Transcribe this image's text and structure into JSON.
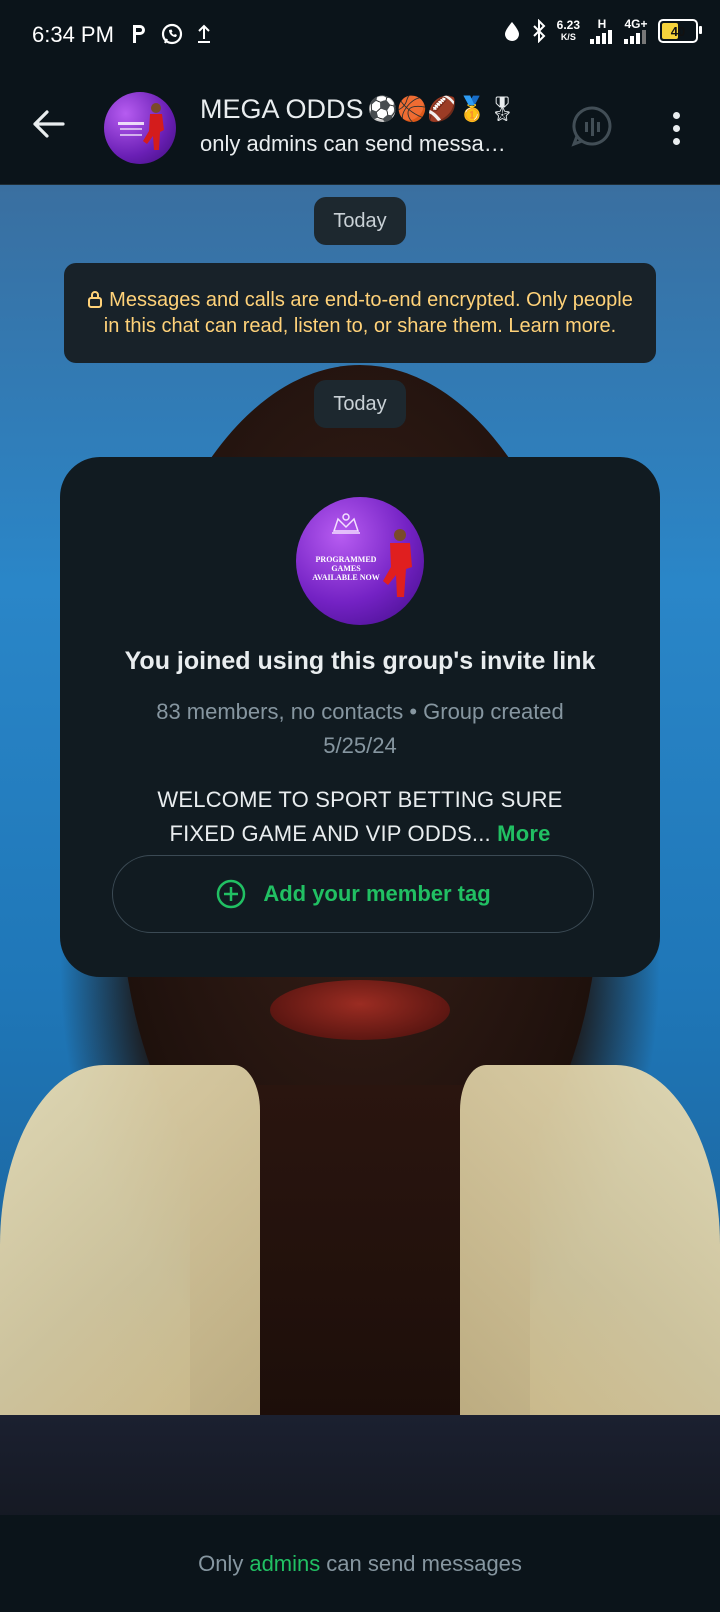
{
  "status_bar": {
    "time": "6:34 PM",
    "left_icons": [
      "p-app-icon",
      "whatsapp-icon",
      "upload-icon"
    ],
    "speed_value": "6.23",
    "speed_unit": "K/S",
    "network": "4G+",
    "signal_h": "H",
    "battery_level": "40"
  },
  "header": {
    "title": "MEGA ODDS",
    "title_emojis": "⚽🏀🏈🥇🎖",
    "subtitle": "only admins can send messa…"
  },
  "chat": {
    "date_chip_1": "Today",
    "encryption_notice": "Messages and calls are end-to-end encrypted. Only people in this chat can read, listen to, or share them. Learn more.",
    "date_chip_2": "Today",
    "card": {
      "avatar_text_1": "PROGRAMMED GAMES",
      "avatar_text_2": "AVAILABLE NOW",
      "title": "You joined using this group's invite link",
      "meta": "83 members, no contacts • Group created 5/25/24",
      "description": "WELCOME TO SPORT BETTING SURE FIXED GAME AND VIP ODDS...",
      "more_label": "More",
      "tag_button_label": "Add your member tag"
    }
  },
  "footer": {
    "prefix": "Only",
    "admins": "admins",
    "suffix": "can send messages"
  },
  "colors": {
    "accent": "#21c063",
    "encryption_text": "#ffd279",
    "background": "#0b141a"
  }
}
